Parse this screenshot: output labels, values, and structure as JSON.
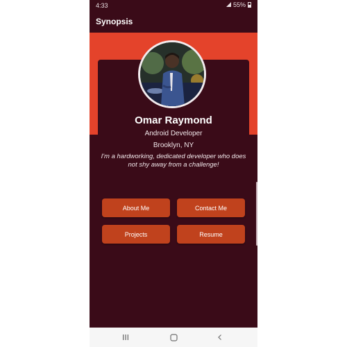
{
  "status_bar": {
    "time": "4:33",
    "battery": "55%",
    "signal_icon": "signal-icon",
    "battery_icon": "battery-icon"
  },
  "app_bar": {
    "title": "Synopsis"
  },
  "profile": {
    "name": "Omar Raymond",
    "role": "Android Developer",
    "location": "Brooklyn, NY",
    "bio": "I'm a hardworking, dedicated developer who does not shy away from a challenge!"
  },
  "buttons": {
    "about": "About Me",
    "contact": "Contact Me",
    "projects": "Projects",
    "resume": "Resume"
  },
  "nav_bar": {
    "recents_icon": "recents-icon",
    "home_icon": "home-icon",
    "back_icon": "back-icon"
  },
  "colors": {
    "background": "#3a0b18",
    "accent": "#e4432b",
    "button": "#c0421d",
    "nav_bar": "#f6f6f6"
  }
}
